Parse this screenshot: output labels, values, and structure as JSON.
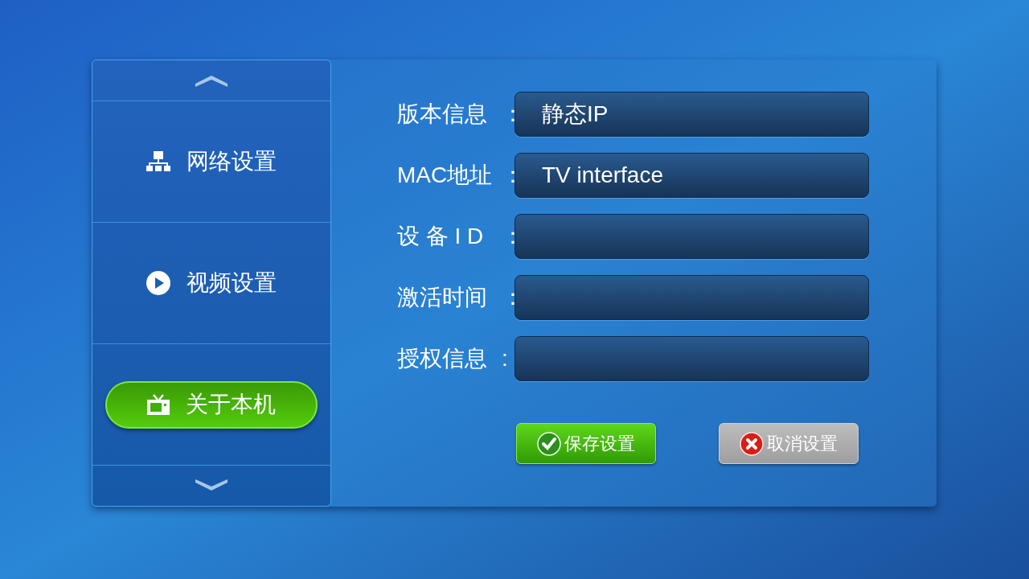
{
  "sidebar": {
    "items": [
      {
        "kind": "network",
        "label": "网络设置",
        "selected": false
      },
      {
        "kind": "video",
        "label": "视频设置",
        "selected": false
      },
      {
        "kind": "tv",
        "label": "关于本机",
        "selected": true
      }
    ]
  },
  "form": {
    "rows": [
      {
        "label": "版本信息",
        "colon": "：",
        "value": "静态IP"
      },
      {
        "label": "MAC地址",
        "colon": "：",
        "value": "TV interface"
      },
      {
        "label": "设 备 I D",
        "colon": "："
      },
      {
        "label": "激活时间",
        "colon": "："
      },
      {
        "label": "授权信息",
        "colon": ":"
      }
    ]
  },
  "buttons": [
    {
      "kind": "save",
      "label": "保存设置"
    },
    {
      "kind": "cancel",
      "label": "取消设置"
    }
  ]
}
